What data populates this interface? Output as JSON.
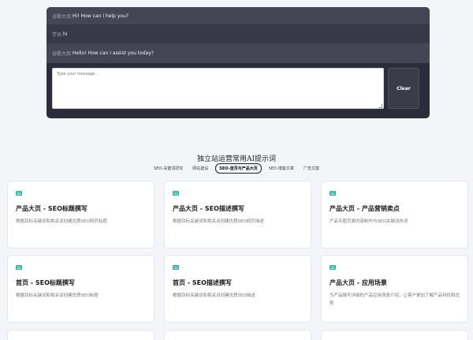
{
  "chat": {
    "messages": [
      {
        "speaker": "谷歌大叔:",
        "text": "Hi! How can I help you?"
      },
      {
        "speaker": "学员:",
        "text": "hi"
      },
      {
        "speaker": "谷歌大叔:",
        "text": "Hello! How can I assist you today?"
      }
    ],
    "input_placeholder": "Type your message...",
    "clear_label": "Clear"
  },
  "section": {
    "title": "独立站运营常用AI提示词",
    "tabs": [
      {
        "label": "SEO-关键词研究",
        "active": false
      },
      {
        "label": "网站建设",
        "active": false
      },
      {
        "label": "SEO-首页与产品大页",
        "active": true
      },
      {
        "label": "SEO-博客文章",
        "active": false
      },
      {
        "label": "广告文案",
        "active": false
      }
    ]
  },
  "cards": [
    {
      "title": "产品大页 - SEO标题撰写",
      "desc": "根据目标关键词和相关词创建优质SEO网页标题"
    },
    {
      "title": "产品大页 - SEO描述撰写",
      "desc": "根据目标关键词和相关词创建优质SEO网页描述"
    },
    {
      "title": "产品大页 - 产品营销卖点",
      "desc": "产品专题页面内容制作与SEO关键词布词"
    },
    {
      "title": "首页 - SEO标题撰写",
      "desc": "根据目标关键词和相关词创建优质SEO标题"
    },
    {
      "title": "首页 - SEO描述撰写",
      "desc": "根据目标关键词和相关词创建优质SEO描述"
    },
    {
      "title": "产品大页 - 应用场景",
      "desc": "为产品撰写详细的产品应用场景介绍，让客户更加了解产品特性和优势"
    }
  ],
  "colors": {
    "icon_accent": "#2bb5a0",
    "chat_bg": "#2b2d3b"
  }
}
